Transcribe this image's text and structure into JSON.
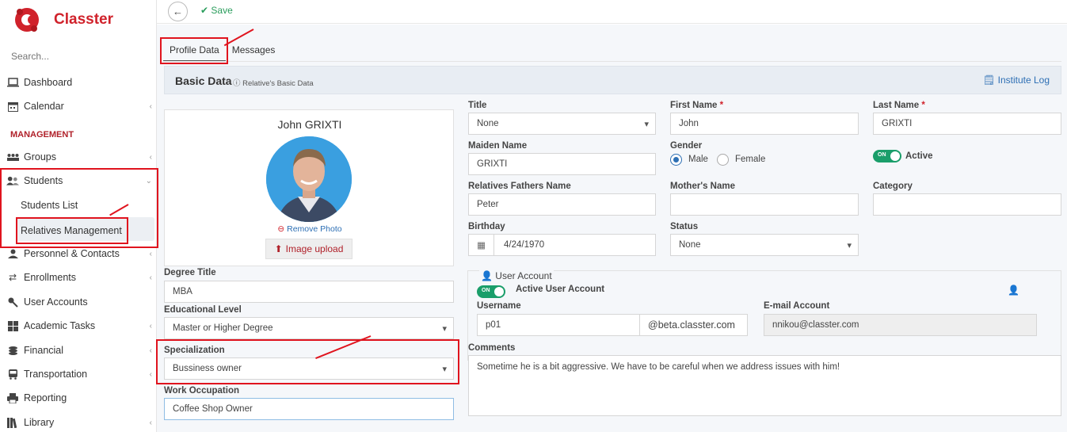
{
  "app": {
    "name": "Classter",
    "search_placeholder": "Search..."
  },
  "sidebar": {
    "dashboard": "Dashboard",
    "calendar": "Calendar",
    "section": "MANAGEMENT",
    "groups": "Groups",
    "students": "Students",
    "students_list": "Students List",
    "relatives_management": "Relatives Management",
    "personnel": "Personnel & Contacts",
    "enrollments": "Enrollments",
    "user_accounts": "User Accounts",
    "academic_tasks": "Academic Tasks",
    "financial": "Financial",
    "transportation": "Transportation",
    "reporting": "Reporting",
    "library": "Library"
  },
  "toolbar": {
    "save_label": "Save"
  },
  "tabs": {
    "profile": "Profile Data",
    "messages": "Messages"
  },
  "basic": {
    "title": "Basic Data",
    "subtitle": "Relative's Basic Data",
    "institute_log": "Institute Log"
  },
  "profile": {
    "name": "John GRIXTI",
    "remove_photo": "Remove Photo",
    "image_upload": "Image upload"
  },
  "left_fields": {
    "degree_title_label": "Degree Title",
    "degree_title": "MBA",
    "edu_level_label": "Educational Level",
    "edu_level": "Master or Higher Degree",
    "specialization_label": "Specialization",
    "specialization": "Bussiness owner",
    "work_label": "Work Occupation",
    "work": "Coffee Shop Owner"
  },
  "fields": {
    "title_label": "Title",
    "title": "None",
    "first_name_label": "First Name",
    "first_name": "John",
    "last_name_label": "Last Name",
    "last_name": "GRIXTI",
    "maiden_label": "Maiden Name",
    "maiden": "GRIXTI",
    "gender_label": "Gender",
    "male": "Male",
    "female": "Female",
    "active": "Active",
    "fathers_label": "Relatives Fathers Name",
    "fathers": "Peter",
    "mothers_label": "Mother's Name",
    "category_label": "Category",
    "birthday_label": "Birthday",
    "birthday": "4/24/1970",
    "status_label": "Status",
    "status": "None"
  },
  "user_account": {
    "title": "User Account",
    "active_label": "Active User Account",
    "toggle_on": "ON",
    "username_label": "Username",
    "username": "p01",
    "domain": "@beta.classter.com",
    "email_label": "E-mail Account",
    "email": "nnikou@classter.com"
  },
  "comments": {
    "label": "Comments",
    "text": "Sometime he is a bit aggressive. We have to be careful when we address issues with him!"
  }
}
